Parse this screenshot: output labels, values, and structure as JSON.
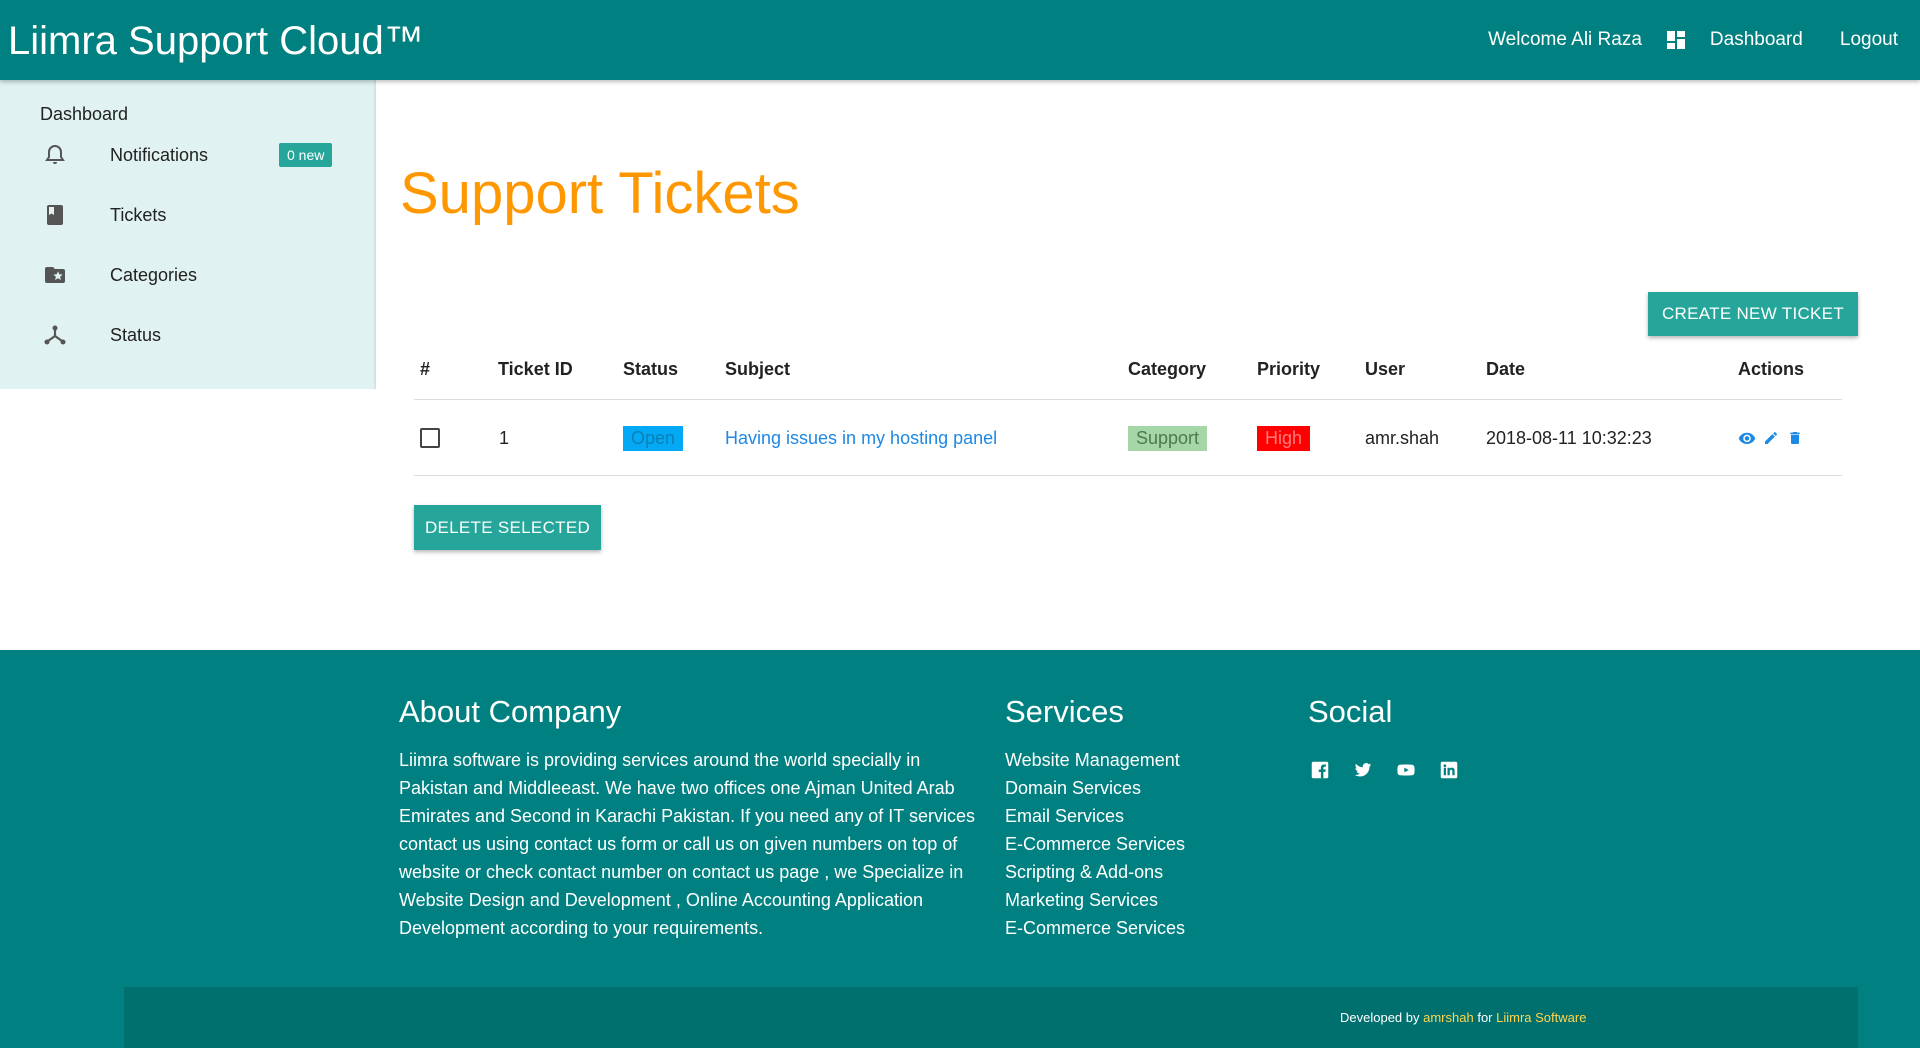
{
  "navbar": {
    "brand": "Liimra Support Cloud™",
    "welcome": "Welcome Ali Raza",
    "dashboard_label": "Dashboard",
    "logout_label": "Logout",
    "dashboard_icon": "dashboard-grid-icon"
  },
  "sidebar": {
    "heading": "Dashboard",
    "items": [
      {
        "label": "Notifications",
        "icon": "bell-icon",
        "badge": "0 new"
      },
      {
        "label": "Tickets",
        "icon": "book-icon"
      },
      {
        "label": "Categories",
        "icon": "folder-star-icon"
      },
      {
        "label": "Status",
        "icon": "hub-icon"
      }
    ]
  },
  "main": {
    "title": "Support Tickets",
    "create_button": "CREATE NEW TICKET",
    "delete_button": "DELETE SELECTED",
    "table": {
      "headers": [
        "#",
        "Ticket ID",
        "Status",
        "Subject",
        "Category",
        "Priority",
        "User",
        "Date",
        "Actions"
      ],
      "rows": [
        {
          "ticket_id": "1",
          "status": "Open",
          "subject": "Having issues in my hosting panel",
          "category": "Support",
          "priority": "High",
          "user": "amr.shah",
          "date": "2018-08-11 10:32:23",
          "actions": [
            "view-icon",
            "edit-icon",
            "delete-icon"
          ]
        }
      ]
    }
  },
  "footer": {
    "about_title": "About Company",
    "about_text": "Liimra software is providing services around the world specially in Pakistan and Middleeast. We have two offices one Ajman United Arab Emirates and Second in Karachi Pakistan. If you need any of IT services contact us using contact us form or call us on given numbers on top of website or check contact number on contact us page , we Specialize in Website Design and Development , Online Accounting Application Development according to your requirements.",
    "services_title": "Services",
    "services": [
      "Website Management",
      "Domain Services",
      "Email Services",
      "E-Commerce Services",
      "Scripting & Add-ons",
      "Marketing Services",
      "E-Commerce Services"
    ],
    "social_title": "Social",
    "social_icons": [
      "facebook-icon",
      "twitter-icon",
      "youtube-icon",
      "linkedin-icon"
    ],
    "credit_prefix": "Developed by",
    "credit_author": "amrshah",
    "credit_mid": "for",
    "credit_company": "Liimra Software"
  },
  "colors": {
    "primary": "#008080",
    "accent": "#26a69a",
    "title": "#ff9800",
    "sidebar_bg": "#e0f2f1",
    "status_open": "#03a9f4",
    "category_support": "#a5d6a7",
    "priority_high": "#ff0000"
  }
}
